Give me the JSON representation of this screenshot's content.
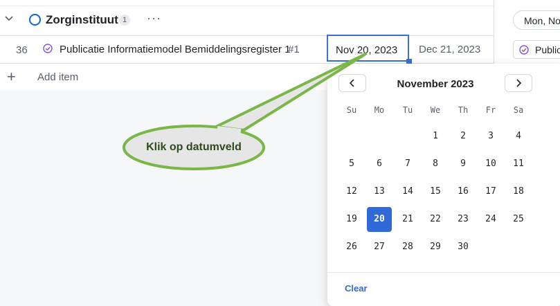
{
  "group": {
    "title": "Zorginstituut",
    "count": "1",
    "more": "···"
  },
  "row": {
    "number": "36",
    "title": "Publicatie Informatiemodel Bemiddelingsregister 1",
    "issue": "#1",
    "start_date": "Nov 20, 2023",
    "end_date": "Dec 21, 2023"
  },
  "add_item": {
    "plus": "+",
    "label": "Add item"
  },
  "right_panel": {
    "date_pill": "Mon, No",
    "item_pill": "Publicati"
  },
  "calendar": {
    "month": "November 2023",
    "weekdays": [
      "Su",
      "Mo",
      "Tu",
      "We",
      "Th",
      "Fr",
      "Sa"
    ],
    "selected": "20",
    "weeks": [
      [
        "",
        "",
        "",
        "1",
        "2",
        "3",
        "4"
      ],
      [
        "5",
        "6",
        "7",
        "8",
        "9",
        "10",
        "11"
      ],
      [
        "12",
        "13",
        "14",
        "15",
        "16",
        "17",
        "18"
      ],
      [
        "19",
        "20",
        "21",
        "22",
        "23",
        "24",
        "25"
      ],
      [
        "26",
        "27",
        "28",
        "29",
        "30",
        "",
        ""
      ]
    ],
    "clear": "Clear"
  },
  "callout": {
    "text": "Klik op datumveld"
  },
  "colors": {
    "accent": "#2f6ad7",
    "callout_fill": "#e6e6e6",
    "callout_border": "#7ab648"
  },
  "icons": [
    "chevron-down-icon",
    "circle-icon",
    "more-icon",
    "check-circle-icon",
    "plus-icon",
    "chevron-left-icon",
    "chevron-right-icon"
  ]
}
